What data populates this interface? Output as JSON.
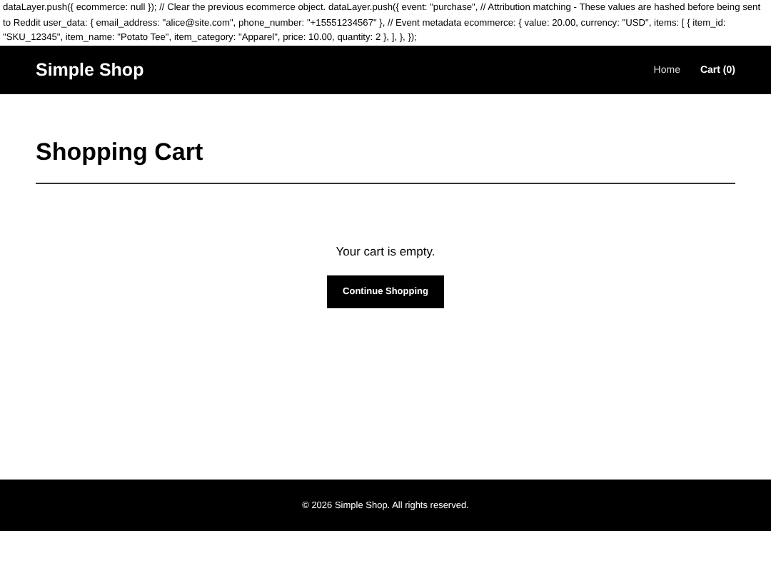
{
  "script_text": "dataLayer.push({ ecommerce: null }); // Clear the previous ecommerce object. dataLayer.push({ event: \"purchase\", // Attribution matching - These values are hashed before being sent to Reddit user_data: { email_address: \"alice@site.com\", phone_number: \"+15551234567\" }, // Event metadata ecommerce: { value: 20.00, currency: \"USD\", items: [ { item_id: \"SKU_12345\", item_name: \"Potato Tee\", item_category: \"Apparel\", price: 10.00, quantity: 2 }, ], }, });",
  "header": {
    "brand": "Simple Shop",
    "nav": [
      {
        "label": "Home",
        "selected": false
      },
      {
        "label": "Cart (0)",
        "selected": true
      }
    ]
  },
  "page_title": "Shopping Cart",
  "empty_message": "Your cart is empty.",
  "continue_button": "Continue Shopping",
  "footer": "© 2026 Simple Shop. All rights reserved."
}
